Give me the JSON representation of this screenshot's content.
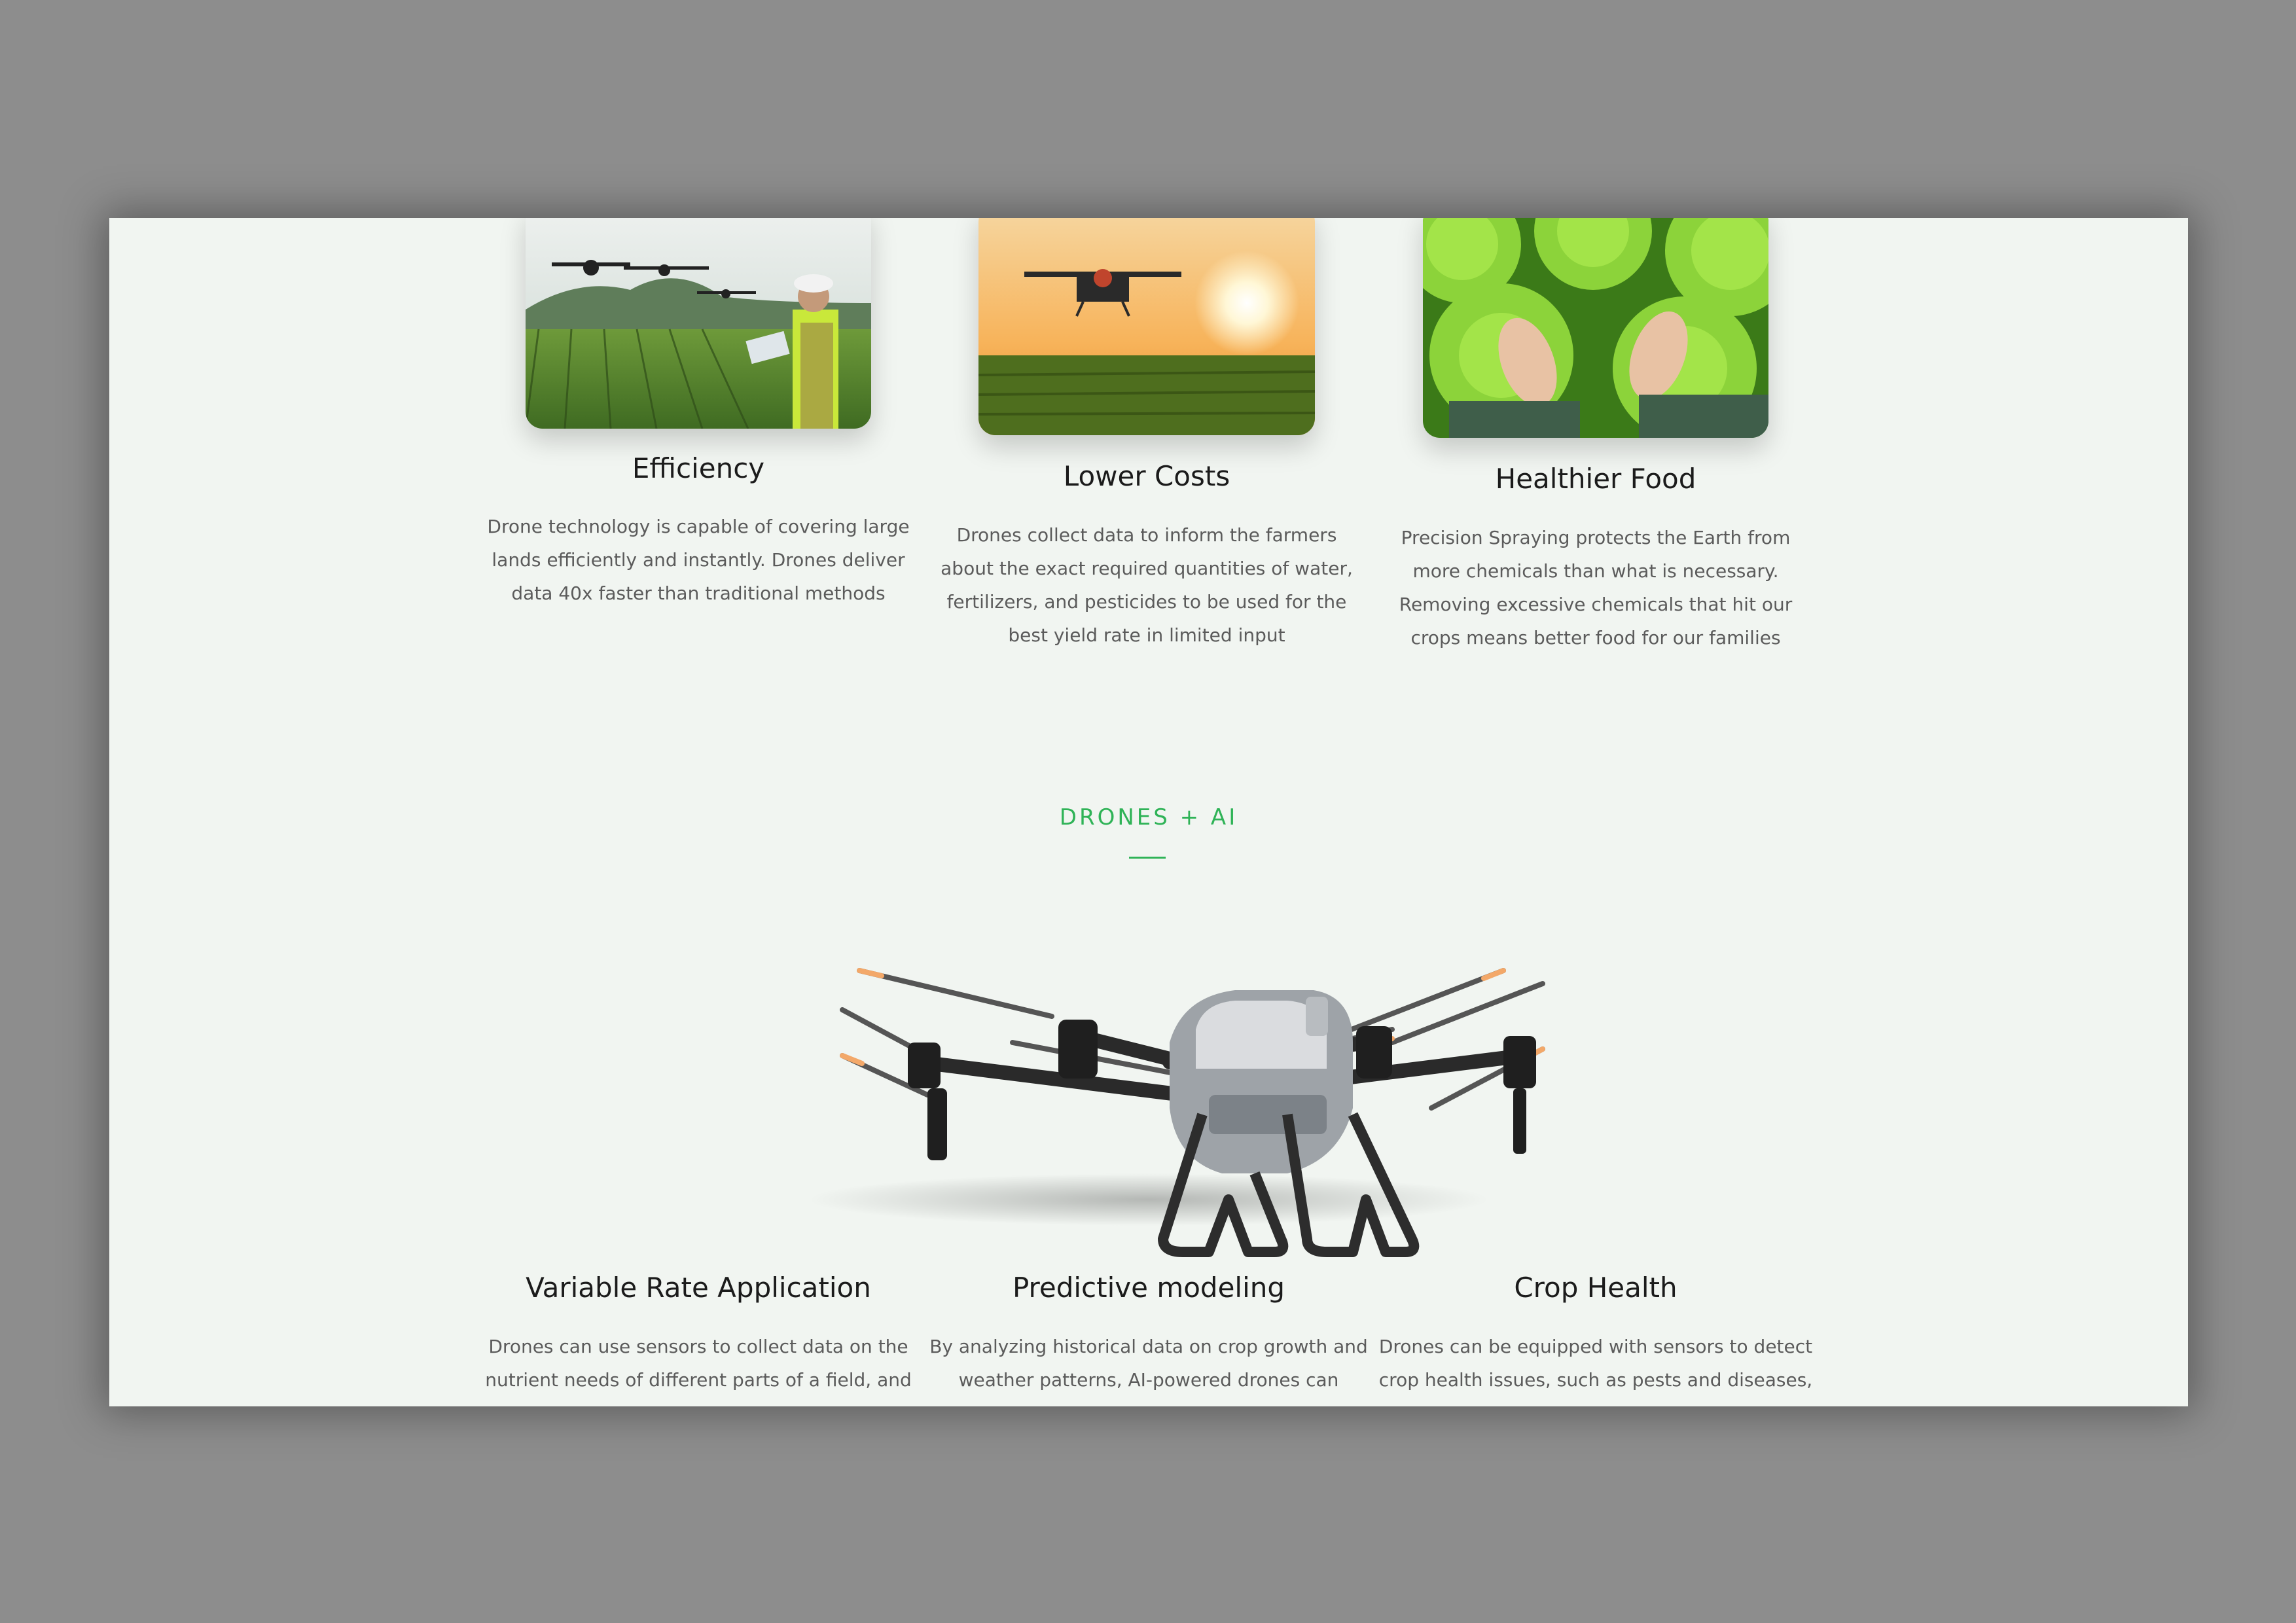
{
  "features": [
    {
      "title": "Efficiency",
      "description": "Drone technology is capable of covering large lands efficiently and instantly. Drones deliver data 40x faster than traditional methods",
      "image": "drone-field-operator-image"
    },
    {
      "title": "Lower Costs",
      "description": "Drones collect data to inform the farmers about the exact required quantities of water, fertilizers, and pesticides to be used for the best yield rate in limited input",
      "image": "drone-sunset-field-image"
    },
    {
      "title": "Healthier Food",
      "description": "Precision Spraying protects the Earth from more chemicals than what is necessary. Removing excessive chemicals that hit our crops means better food for our families",
      "image": "lettuce-hands-image"
    }
  ],
  "section": {
    "eyebrow": "DRONES + AI",
    "accent_color": "#2fb357",
    "hero_image": "agricultural-spray-drone-image"
  },
  "ai_features": [
    {
      "title": "Variable Rate Application",
      "description": "Drones can use sensors to collect data on the nutrient needs of different parts of a field, and"
    },
    {
      "title": "Predictive modeling",
      "description": "By analyzing historical data on crop growth and weather patterns, AI-powered drones can"
    },
    {
      "title": "Crop Health",
      "description": "Drones can be equipped with sensors to detect crop health issues, such as pests and diseases,"
    }
  ]
}
